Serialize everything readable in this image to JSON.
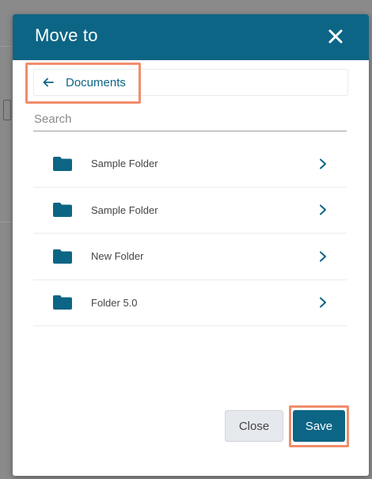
{
  "dialog": {
    "title": "Move to",
    "close_icon": "close-x-icon"
  },
  "breadcrumb": {
    "back_icon": "arrow-left-icon",
    "label": "Documents"
  },
  "search": {
    "placeholder": "Search",
    "value": ""
  },
  "folders": [
    {
      "name": "Sample Folder",
      "icon": "folder-icon"
    },
    {
      "name": "Sample Folder",
      "icon": "folder-icon"
    },
    {
      "name": "New Folder",
      "icon": "folder-icon"
    },
    {
      "name": "Folder 5.0",
      "icon": "folder-icon"
    }
  ],
  "footer": {
    "close_label": "Close",
    "save_label": "Save"
  },
  "colors": {
    "header": "#0d6585",
    "accent": "#0d6585",
    "highlight": "#f08d6b"
  }
}
